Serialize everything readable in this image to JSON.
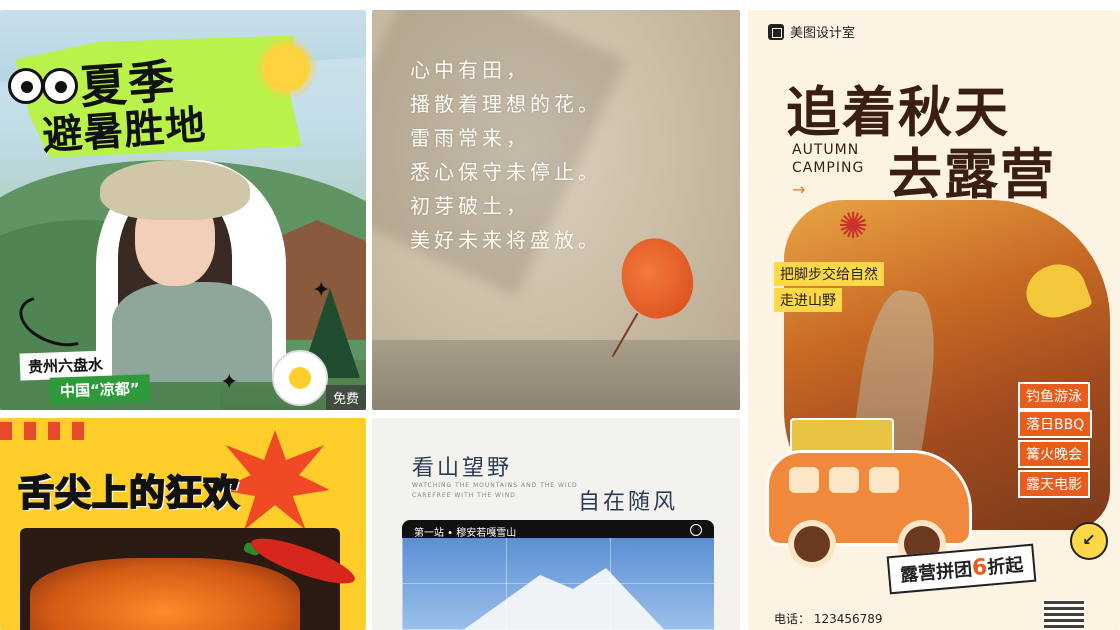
{
  "cards": {
    "summer": {
      "title_line1": "夏季",
      "title_line2": "避暑胜地",
      "tag1": "贵州六盘水",
      "tag2": "中国“凉都”",
      "free_label": "免费",
      "colors": {
        "accent": "#b8f24a",
        "tag": "#2e9a3a"
      }
    },
    "poem": {
      "lines": [
        "心中有田，",
        "播散着理想的花。",
        "雷雨常来，",
        "悉心保守未停止。",
        "初芽破土，",
        "美好未来将盛放。"
      ]
    },
    "autumn": {
      "brand": "美图设计室",
      "title_line1": "追着秋天",
      "title_line2": "去露营",
      "en_line1": "AUTUMN",
      "en_line2": "CAMPING",
      "highlight1": "把脚步交给自然",
      "highlight2": "走进山野",
      "activities": [
        "钓鱼游泳",
        "落日BBQ",
        "篝火晚会",
        "露天电影"
      ],
      "badge_prefix": "露营拼团",
      "badge_number": "6",
      "badge_suffix": "折起",
      "phone": "电话： 123456789",
      "colors": {
        "accent": "#e85d1c",
        "highlight": "#ffd84a"
      }
    },
    "spicy": {
      "title": "舌尖上的狂欢",
      "colors": {
        "background": "#ffce2b",
        "burst": "#ef4a24"
      }
    },
    "mountain": {
      "title1": "看山望野",
      "title2": "自在随风",
      "en_line1": "WATCHING THE MOUNTAINS AND THE WILD",
      "en_line2": "CAREFREE WITH THE WIND",
      "photo_bar": "第一站 • 穆安若嘎雪山"
    }
  }
}
